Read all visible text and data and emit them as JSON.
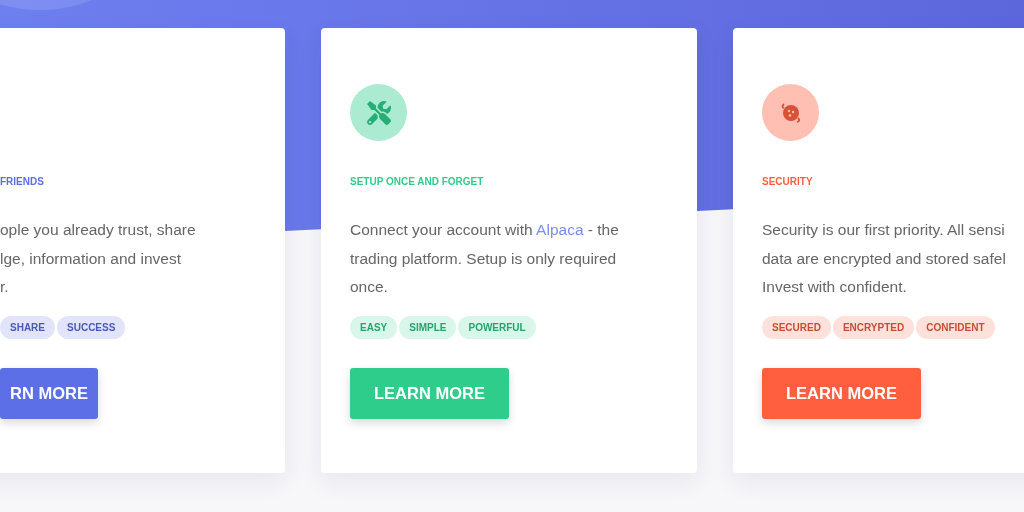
{
  "cards": [
    {
      "color": "#5d6fe6",
      "title": "FRIENDS",
      "lines": [
        [
          {
            "kind": "text",
            "text": "ople you already trust, share"
          }
        ],
        [
          {
            "kind": "text",
            "text": "lge, information and invest"
          }
        ],
        [
          {
            "kind": "text",
            "text": "r."
          }
        ]
      ],
      "tags": [
        "SHARE",
        "SUCCESS"
      ],
      "button": "RN MORE"
    },
    {
      "color": "#2ecd8b",
      "title": "SETUP ONCE AND FORGET",
      "lines": [
        [
          {
            "kind": "text",
            "text": "Connect your account with "
          },
          {
            "kind": "link",
            "text": "Alpaca"
          },
          {
            "kind": "text",
            "text": " - the"
          }
        ],
        [
          {
            "kind": "text",
            "text": "trading platform. Setup is only required"
          }
        ],
        [
          {
            "kind": "text",
            "text": "once."
          }
        ]
      ],
      "tags": [
        "EASY",
        "SIMPLE",
        "POWERFUL"
      ],
      "button": "LEARN MORE"
    },
    {
      "color": "#ff5f3f",
      "title": "SECURITY",
      "lines": [
        [
          {
            "kind": "text",
            "text": "Security is our first priority. All sensi"
          }
        ],
        [
          {
            "kind": "text",
            "text": "data are encrypted and stored safel"
          }
        ],
        [
          {
            "kind": "text",
            "text": "Invest with confident."
          }
        ]
      ],
      "tags": [
        "SECURED",
        "ENCRYPTED",
        "CONFIDENT"
      ],
      "button": "LEARN MORE"
    }
  ]
}
